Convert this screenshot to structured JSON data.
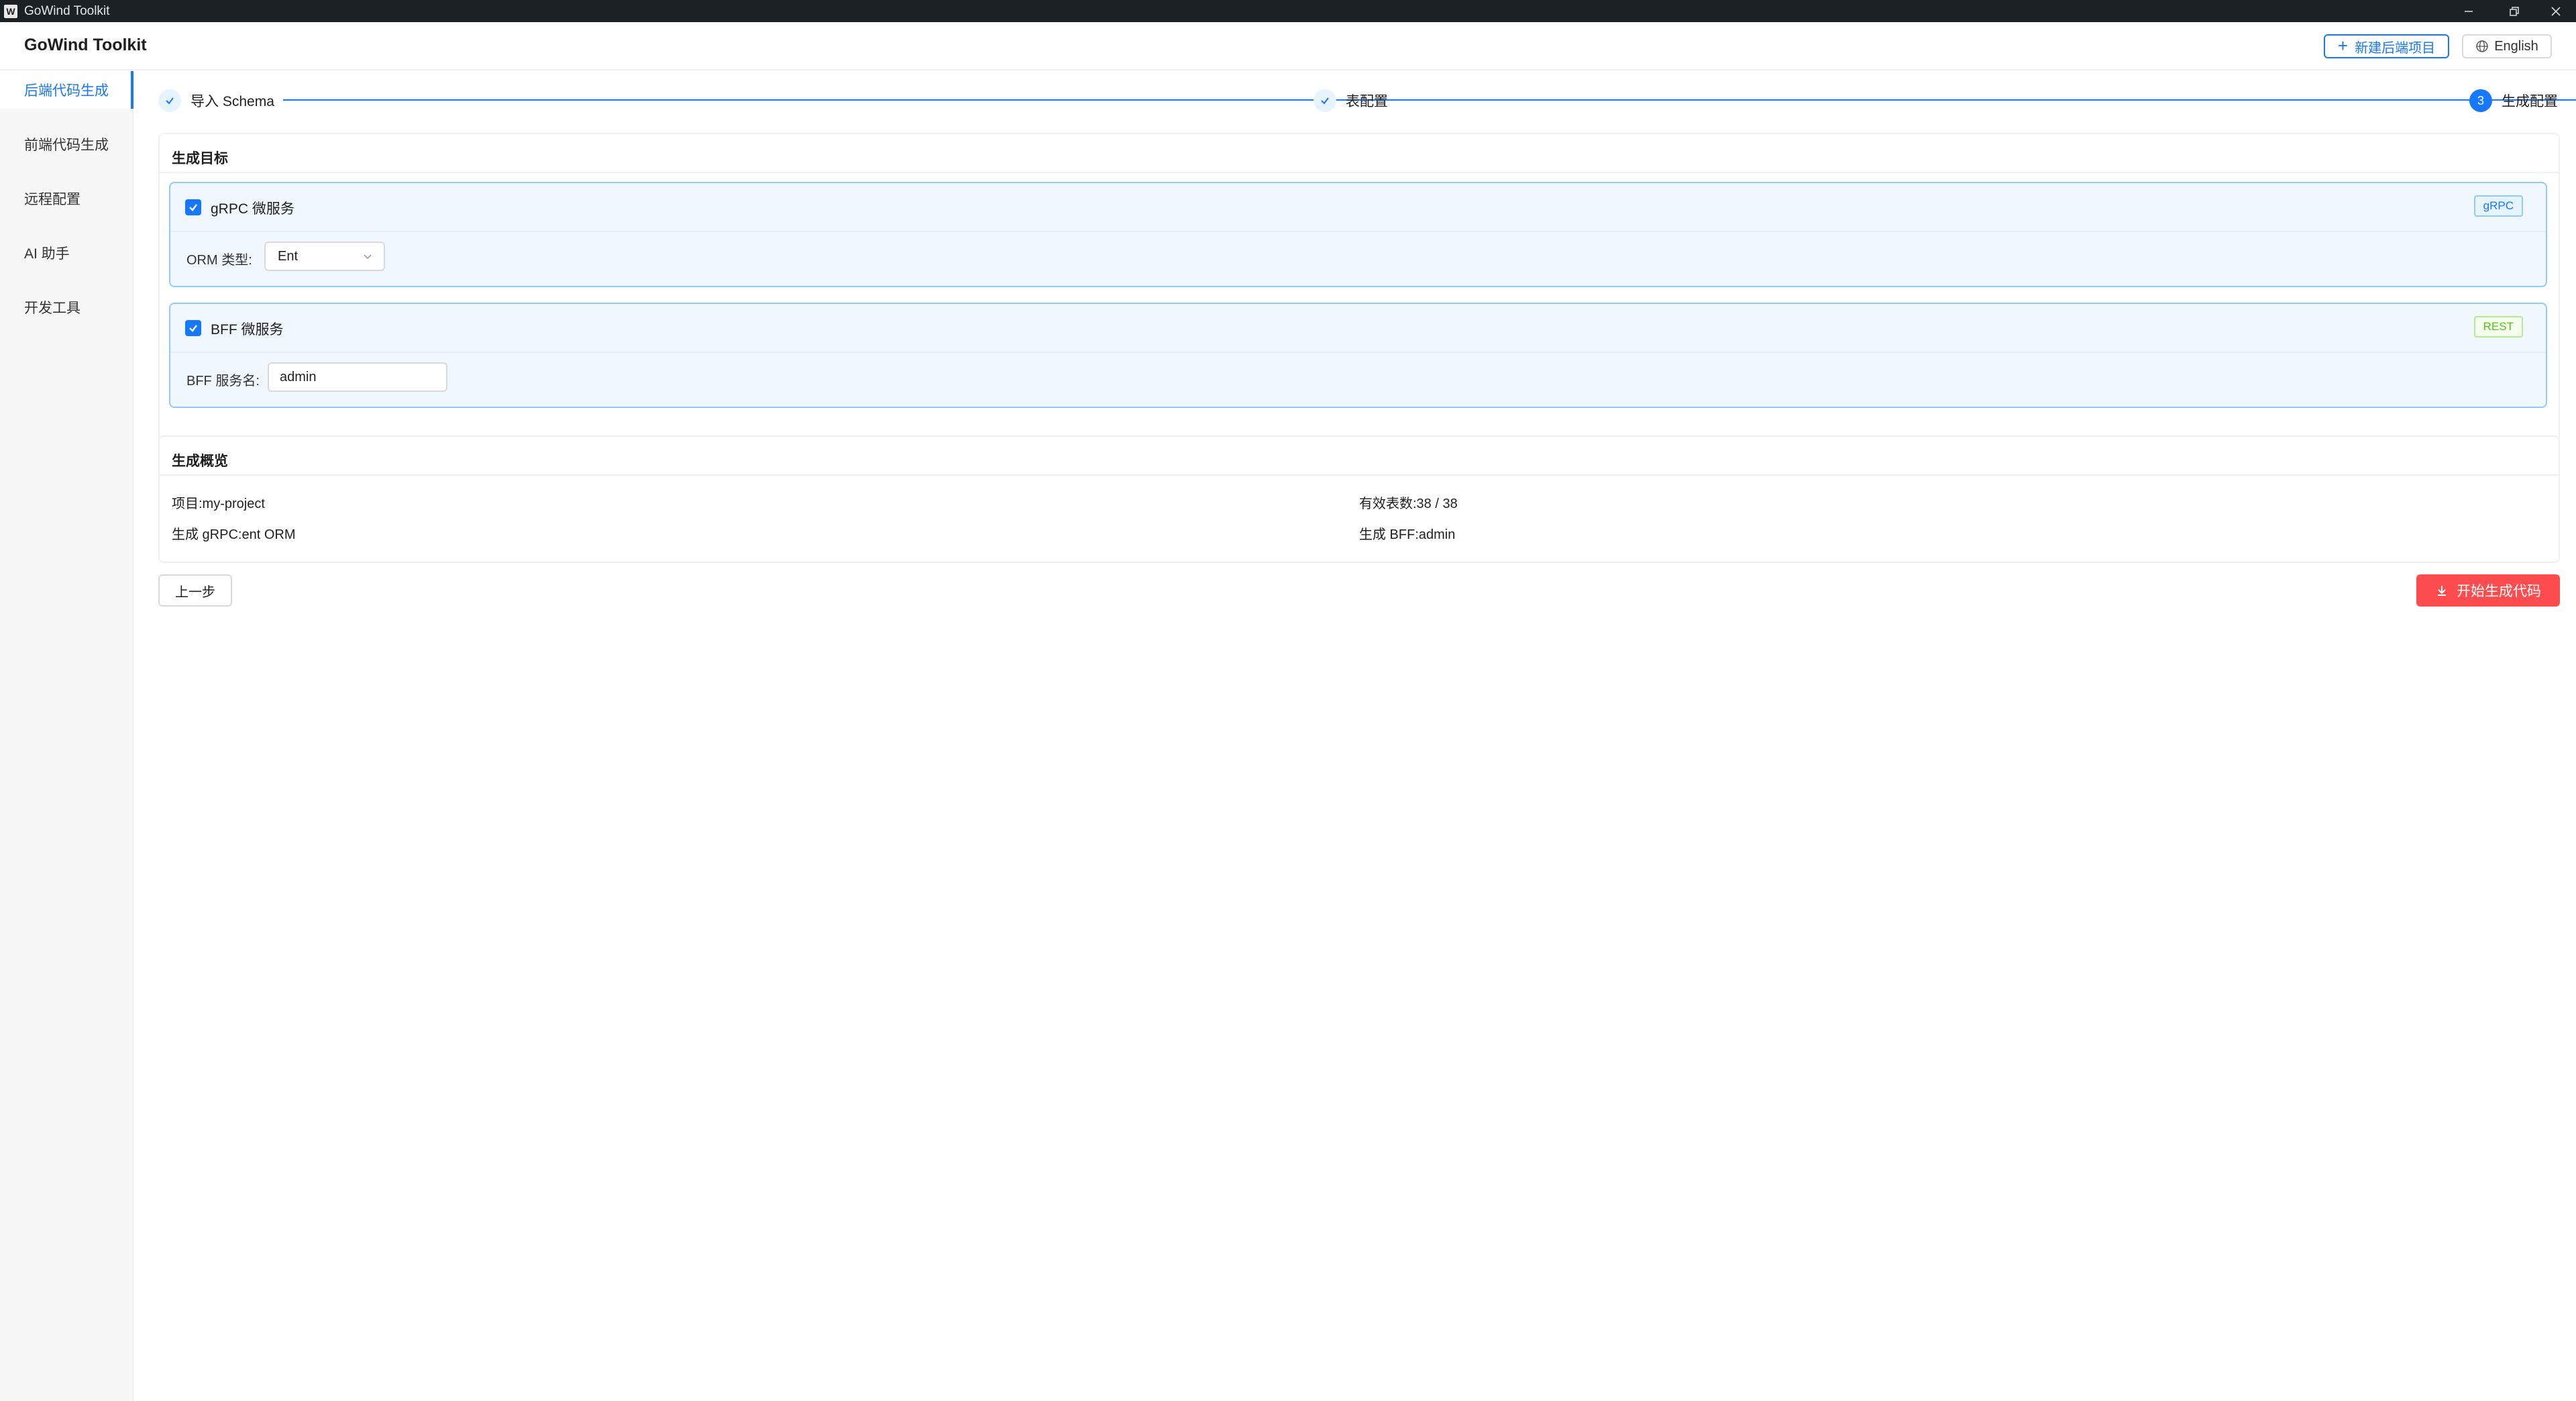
{
  "window": {
    "title": "GoWind Toolkit",
    "icon_letter": "W"
  },
  "header": {
    "brand": "GoWind Toolkit",
    "new_project_label": "新建后端项目",
    "language_label": "English"
  },
  "sidebar": {
    "items": [
      {
        "label": "后端代码生成",
        "active": true
      },
      {
        "label": "前端代码生成"
      },
      {
        "label": "远程配置"
      },
      {
        "label": "AI 助手"
      },
      {
        "label": "开发工具"
      }
    ]
  },
  "steps": [
    {
      "label": "导入 Schema",
      "status": "done"
    },
    {
      "label": "表配置",
      "status": "done"
    },
    {
      "label": "生成配置",
      "status": "current",
      "number": "3"
    }
  ],
  "targets": {
    "title": "生成目标",
    "grpc": {
      "label": "gRPC 微服务",
      "checked": true,
      "tag": "gRPC",
      "orm_label": "ORM 类型:",
      "orm_value": "Ent"
    },
    "bff": {
      "label": "BFF 微服务",
      "checked": true,
      "tag": "REST",
      "name_label": "BFF 服务名:",
      "name_value": "admin"
    }
  },
  "summary": {
    "title": "生成概览",
    "project": "项目:my-project",
    "tables": "有效表数:38 / 38",
    "grpc": "生成 gRPC:ent ORM",
    "bff": "生成 BFF:admin"
  },
  "actions": {
    "prev_label": "上一步",
    "generate_label": "开始生成代码"
  },
  "colors": {
    "primary": "#1677ff",
    "danger": "#ff4d4f",
    "success": "#52c41a"
  }
}
